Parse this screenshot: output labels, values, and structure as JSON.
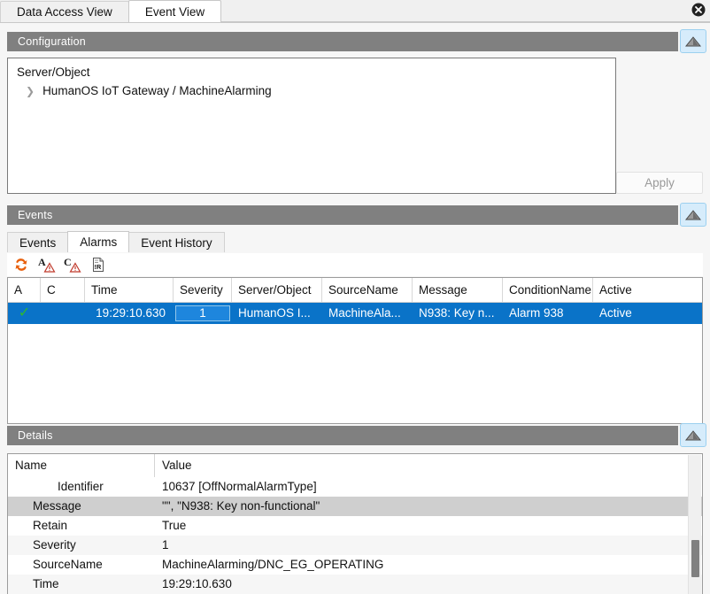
{
  "window": {
    "close_icon": "close-circle-icon",
    "tabs": [
      {
        "label": "Data Access View",
        "active": false
      },
      {
        "label": "Event View",
        "active": true
      }
    ]
  },
  "configuration": {
    "title": "Configuration",
    "collapse_icon": "triangle-up-icon",
    "tree_header": "Server/Object",
    "expander_icon": "chevron-right-icon",
    "node_label": "HumanOS IoT Gateway / MachineAlarming",
    "apply_label": "Apply",
    "apply_enabled": false
  },
  "events": {
    "title": "Events",
    "collapse_icon": "triangle-up-icon",
    "tabs": [
      {
        "label": "Events",
        "active": false
      },
      {
        "label": "Alarms",
        "active": true
      },
      {
        "label": "Event History",
        "active": false
      }
    ],
    "toolbar": [
      {
        "name": "refresh-icon",
        "glyph": "refresh"
      },
      {
        "name": "acknowledge-alarm-icon",
        "glyph": "A"
      },
      {
        "name": "confirm-alarm-icon",
        "glyph": "C"
      },
      {
        "name": "report-icon",
        "glyph": "!R"
      }
    ],
    "grid": {
      "columns": [
        "A",
        "C",
        "Time",
        "Severity",
        "Server/Object",
        "SourceName",
        "Message",
        "ConditionName",
        "Active"
      ],
      "rows": [
        {
          "a": "✓",
          "c": "",
          "time": "19:29:10.630",
          "severity": "1",
          "server_object": "HumanOS I...",
          "source_name": "MachineAla...",
          "message": "N938: Key n...",
          "condition_name": "Alarm 938",
          "active": "Active",
          "selected": true
        }
      ]
    }
  },
  "details": {
    "title": "Details",
    "collapse_icon": "triangle-up-icon",
    "columns": [
      "Name",
      "Value"
    ],
    "rows": [
      {
        "name": "Identifier",
        "value": "10637 [OffNormalAlarmType]",
        "indent": 2,
        "selected": false,
        "alt": false
      },
      {
        "name": "Message",
        "value": "\"\", \"N938: Key non-functional\"",
        "indent": 1,
        "selected": true,
        "alt": false
      },
      {
        "name": "Retain",
        "value": "True",
        "indent": 1,
        "selected": false,
        "alt": false
      },
      {
        "name": "Severity",
        "value": "1",
        "indent": 1,
        "selected": false,
        "alt": true
      },
      {
        "name": "SourceName",
        "value": "MachineAlarming/DNC_EG_OPERATING",
        "indent": 1,
        "selected": false,
        "alt": false
      },
      {
        "name": "Time",
        "value": "19:29:10.630",
        "indent": 1,
        "selected": false,
        "alt": true
      }
    ],
    "scrollbar": "vertical-scrollbar"
  },
  "colors": {
    "section_bar": "#808080",
    "selection_blue": "#0a73c8",
    "collapse_button": "#d6ecfb",
    "check_green": "#2eb82e",
    "refresh_orange": "#e8600d"
  }
}
